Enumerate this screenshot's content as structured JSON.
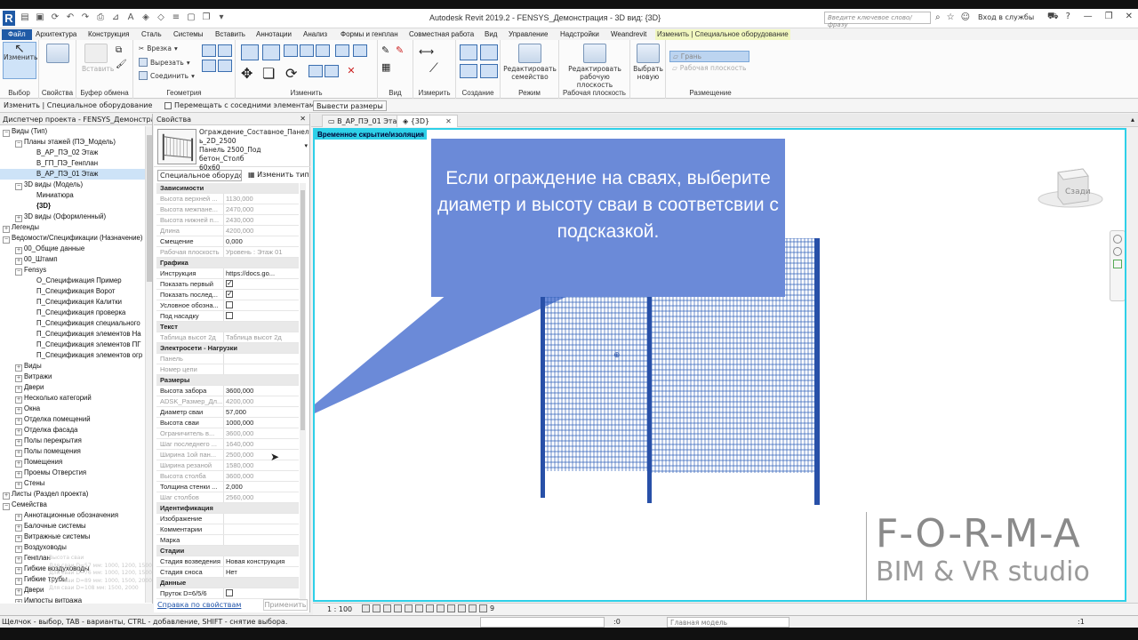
{
  "window": {
    "title": "Autodesk Revit 2019.2 - FENSYS_Демонстрация - 3D вид: {3D}",
    "search_placeholder": "Введите ключевое слово/фразу",
    "login": "Вход в службы",
    "logo": "R"
  },
  "ribbon_tabs": [
    {
      "label": "Файл"
    },
    {
      "label": "Архитектура"
    },
    {
      "label": "Конструкция"
    },
    {
      "label": "Сталь"
    },
    {
      "label": "Системы"
    },
    {
      "label": "Вставить"
    },
    {
      "label": "Аннотации"
    },
    {
      "label": "Анализ"
    },
    {
      "label": "Формы и генплан"
    },
    {
      "label": "Совместная работа"
    },
    {
      "label": "Вид"
    },
    {
      "label": "Управление"
    },
    {
      "label": "Надстройки"
    },
    {
      "label": "Weandrevit"
    },
    {
      "label": "Изменить | Специальное оборудование"
    }
  ],
  "ribbon": {
    "modify": "Изменить",
    "paste": "Вставить",
    "cut_notch": "Врезка",
    "cut": "Вырезать",
    "join": "Соединить",
    "edit_family": "Редактировать семейство",
    "edit_workplane": "Редактировать рабочую плоскость",
    "pick_new": "Выбрать новую",
    "face": "Грань",
    "work_plane": "Рабочая плоскость",
    "groups": {
      "select": "Выбор",
      "properties": "Свойства",
      "clipboard": "Буфер обмена",
      "geometry": "Геометрия",
      "modify": "Изменить",
      "view": "Вид",
      "measure": "Измерить",
      "create": "Создание",
      "mode": "Режим",
      "workplane": "Рабочая плоскость",
      "placement": "Размещение"
    }
  },
  "options_bar": {
    "context": "Изменить | Специальное оборудование",
    "move_with_nearby": "Перемещать с соседними элементами",
    "show_dims": "Вывести размеры"
  },
  "project_browser": {
    "title": "Диспетчер проекта - FENSYS_Демонстрация...",
    "items": [
      {
        "label": "Виды (Тип)",
        "level": 0,
        "toggle": "−"
      },
      {
        "label": "Планы этажей (ПЭ_Модель)",
        "level": 1,
        "toggle": "−"
      },
      {
        "label": "В_АР_ПЭ_02 Этаж",
        "level": 2,
        "toggle": ""
      },
      {
        "label": "В_ГП_ПЭ_Генплан",
        "level": 2,
        "toggle": ""
      },
      {
        "label": "В_АР_ПЭ_01 Этаж",
        "level": 2,
        "toggle": "",
        "selected": true
      },
      {
        "label": "3D виды (Модель)",
        "level": 1,
        "toggle": "−"
      },
      {
        "label": "Миниатюра",
        "level": 2,
        "toggle": ""
      },
      {
        "label": "{3D}",
        "level": 2,
        "toggle": "",
        "bold": true
      },
      {
        "label": "3D виды (Оформленный)",
        "level": 1,
        "toggle": "+"
      },
      {
        "label": "Легенды",
        "level": 0,
        "toggle": "+"
      },
      {
        "label": "Ведомости/Спецификации (Назначение)",
        "level": 0,
        "toggle": "−"
      },
      {
        "label": "00_Общие данные",
        "level": 1,
        "toggle": "+"
      },
      {
        "label": "00_Штамп",
        "level": 1,
        "toggle": "+"
      },
      {
        "label": "Fensys",
        "level": 1,
        "toggle": "−"
      },
      {
        "label": "О_Спецификация Пример",
        "level": 2,
        "toggle": ""
      },
      {
        "label": "П_Спецификация Ворот",
        "level": 2,
        "toggle": ""
      },
      {
        "label": "П_Спецификация Калитки",
        "level": 2,
        "toggle": ""
      },
      {
        "label": "П_Спецификация проверка",
        "level": 2,
        "toggle": ""
      },
      {
        "label": "П_Спецификация специального",
        "level": 2,
        "toggle": ""
      },
      {
        "label": "П_Спецификация элементов На",
        "level": 2,
        "toggle": ""
      },
      {
        "label": "П_Спецификация элементов ПГ",
        "level": 2,
        "toggle": ""
      },
      {
        "label": "П_Спецификация элементов огр",
        "level": 2,
        "toggle": ""
      },
      {
        "label": "Виды",
        "level": 1,
        "toggle": "+"
      },
      {
        "label": "Витражи",
        "level": 1,
        "toggle": "+"
      },
      {
        "label": "Двери",
        "level": 1,
        "toggle": "+"
      },
      {
        "label": "Несколько категорий",
        "level": 1,
        "toggle": "+"
      },
      {
        "label": "Окна",
        "level": 1,
        "toggle": "+"
      },
      {
        "label": "Отделка помещений",
        "level": 1,
        "toggle": "+"
      },
      {
        "label": "Отделка фасада",
        "level": 1,
        "toggle": "+"
      },
      {
        "label": "Полы перекрытия",
        "level": 1,
        "toggle": "+"
      },
      {
        "label": "Полы помещения",
        "level": 1,
        "toggle": "+"
      },
      {
        "label": "Помещения",
        "level": 1,
        "toggle": "+"
      },
      {
        "label": "Проемы Отверстия",
        "level": 1,
        "toggle": "+"
      },
      {
        "label": "Стены",
        "level": 1,
        "toggle": "+"
      },
      {
        "label": "Листы (Раздел проекта)",
        "level": 0,
        "toggle": "+"
      },
      {
        "label": "Семейства",
        "level": 0,
        "toggle": "−"
      },
      {
        "label": "Аннотационные обозначения",
        "level": 1,
        "toggle": "+"
      },
      {
        "label": "Балочные системы",
        "level": 1,
        "toggle": "+"
      },
      {
        "label": "Витражные системы",
        "level": 1,
        "toggle": "+"
      },
      {
        "label": "Воздуховоды",
        "level": 1,
        "toggle": "+"
      },
      {
        "label": "Генплан",
        "level": 1,
        "toggle": "+"
      },
      {
        "label": "Гибкие воздуховоды",
        "level": 1,
        "toggle": "+"
      },
      {
        "label": "Гибкие трубы",
        "level": 1,
        "toggle": "+"
      },
      {
        "label": "Двери",
        "level": 1,
        "toggle": "+"
      },
      {
        "label": "Импосты витража",
        "level": 1,
        "toggle": "+"
      }
    ]
  },
  "properties": {
    "title": "Свойства",
    "type_name": [
      "Ограждение_Составное_Панел",
      "ь_2D_2500",
      "Панель 2500_Под бетон_Столб",
      "60x60"
    ],
    "category_dropdown": "Специальное оборудо",
    "edit_type": "Изменить тип",
    "rows": [
      {
        "kind": "cat",
        "name": "Зависимости"
      },
      {
        "name": "Высота верхней ...",
        "value": "1130,000",
        "gray": true
      },
      {
        "name": "Высота межпане...",
        "value": "2470,000",
        "gray": true
      },
      {
        "name": "Высота нижней п...",
        "value": "2430,000",
        "gray": true
      },
      {
        "name": "Длина",
        "value": "4200,000",
        "gray": true
      },
      {
        "name": "Смещение",
        "value": "0,000"
      },
      {
        "name": "Рабочая плоскость",
        "value": "Уровень : Этаж 01",
        "gray": true
      },
      {
        "kind": "cat",
        "name": "Графика"
      },
      {
        "name": "Инструкция",
        "value": "https://docs.go..."
      },
      {
        "name": "Показать первый",
        "check": true
      },
      {
        "name": "Показать послед...",
        "check": true
      },
      {
        "name": "Условное обозна...",
        "check": false
      },
      {
        "name": "Под насадку",
        "check": false
      },
      {
        "kind": "cat",
        "name": "Текст"
      },
      {
        "name": "Таблица высот 2д",
        "value": "Таблица высот 2д",
        "gray": true
      },
      {
        "kind": "cat",
        "name": "Электросети - Нагрузки"
      },
      {
        "name": "Панель",
        "value": "",
        "gray": true
      },
      {
        "name": "Номер цепи",
        "value": "",
        "gray": true
      },
      {
        "kind": "cat",
        "name": "Размеры"
      },
      {
        "name": "Высота забора",
        "value": "3600,000"
      },
      {
        "name": "ADSK_Размер_Дл...",
        "value": "4200,000",
        "gray": true
      },
      {
        "name": "Диаметр сваи",
        "value": "57,000"
      },
      {
        "name": "Высота сваи",
        "value": "1000,000"
      },
      {
        "name": "Ограничитель в...",
        "value": "3600,000",
        "gray": true
      },
      {
        "name": "Шаг последнего ...",
        "value": "1640,000",
        "gray": true
      },
      {
        "name": "Ширина 1ой пан...",
        "value": "2500,000",
        "gray": true
      },
      {
        "name": "Ширина резаной",
        "value": "1580,000",
        "gray": true
      },
      {
        "name": "Высота столба",
        "value": "3600,000",
        "gray": true
      },
      {
        "name": "Толщина стенки ...",
        "value": "2,000"
      },
      {
        "name": "Шаг столбов",
        "value": "2560,000",
        "gray": true
      },
      {
        "kind": "cat",
        "name": "Идентификация"
      },
      {
        "name": "Изображение",
        "value": ""
      },
      {
        "name": "Комментарии",
        "value": ""
      },
      {
        "name": "Марка",
        "value": ""
      },
      {
        "kind": "cat",
        "name": "Стадии"
      },
      {
        "name": "Стадия возведения",
        "value": "Новая конструкция"
      },
      {
        "name": "Стадия сноса",
        "value": "Нет"
      },
      {
        "kind": "cat",
        "name": "Данные"
      },
      {
        "name": "Пруток D=6/5/6",
        "check": false
      }
    ],
    "help_link": "Справка по свойствам",
    "apply": "Применить"
  },
  "tooltip_ghost": [
    "Высота сваи",
    "Для сваи D=57 мм: 1000, 1200, 1500",
    "Для сваи D=76 мм: 1000, 1200, 1500",
    "Для сваи D=89 мм: 1000, 1500, 2000",
    "Для сваи D=108 мм: 1500, 2000"
  ],
  "doc_tabs": [
    {
      "label": "В_АР_ПЭ_01 Этаж"
    },
    {
      "label": "{3D}"
    }
  ],
  "view": {
    "hide_badge": "Временное скрытие/изоляция",
    "viewcube_label": "Сзади",
    "callout_text": "Если ограждение на сваях, выберите диаметр и высоту сваи в соответсвии с подсказкой.",
    "watermark_1": "F-O-R-M-A",
    "watermark_2": "BIM & VR studio"
  },
  "view_status": {
    "scale": "1 : 100",
    "detail_count": "9"
  },
  "status_bar": {
    "message": "Щелчок - выбор, TAB - варианты, CTRL - добавление, SHIFT - снятие выбора.",
    "selection_count": ":0",
    "model": "Главная модель",
    "filter_count": ":1"
  },
  "colors": {
    "accent": "#1f5aa6",
    "contextual_tab": "#f1f7bf",
    "isolation": "#2ed0e8",
    "callout": "#6b8ad8",
    "fence": "#2e5fb8"
  }
}
